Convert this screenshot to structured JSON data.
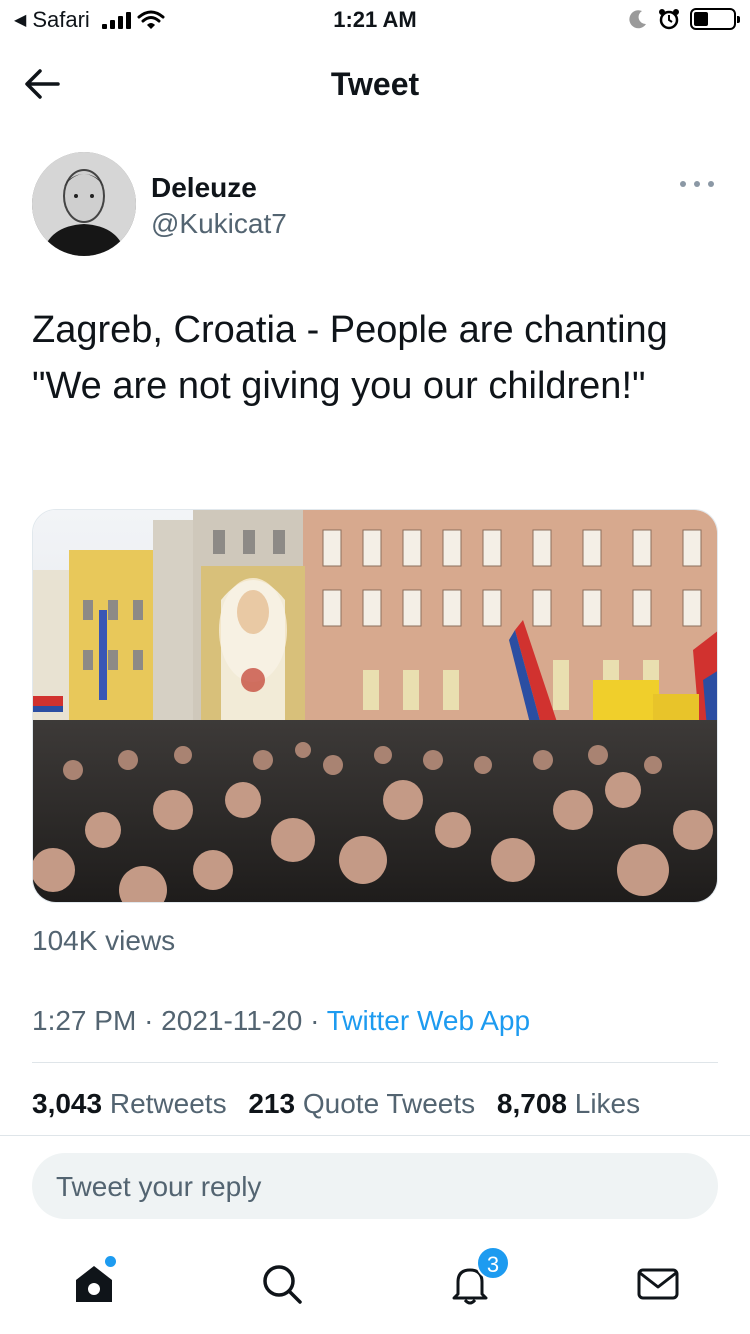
{
  "status_bar": {
    "back_app": "Safari",
    "time": "1:21 AM"
  },
  "header": {
    "title": "Tweet"
  },
  "tweet": {
    "author_name": "Deleuze",
    "author_handle": "@Kukicat7",
    "text": "Zagreb, Croatia - People are chanting \"We are not giving you our children!\"",
    "views": "104K views",
    "time": "1:27 PM",
    "date": "2021-11-20",
    "source": "Twitter Web App",
    "separator": "·"
  },
  "stats": {
    "retweets_count": "3,043",
    "retweets_label": "Retweets",
    "quotes_count": "213",
    "quotes_label": "Quote Tweets",
    "likes_count": "8,708",
    "likes_label": "Likes"
  },
  "reply": {
    "placeholder": "Tweet your reply"
  },
  "tabbar": {
    "notifications_badge": "3",
    "items": [
      "home-icon",
      "search-icon",
      "bell-icon",
      "mail-icon"
    ]
  },
  "colors": {
    "accent": "#1d9bf0",
    "text_primary": "#0f1419",
    "text_secondary": "#536471"
  }
}
